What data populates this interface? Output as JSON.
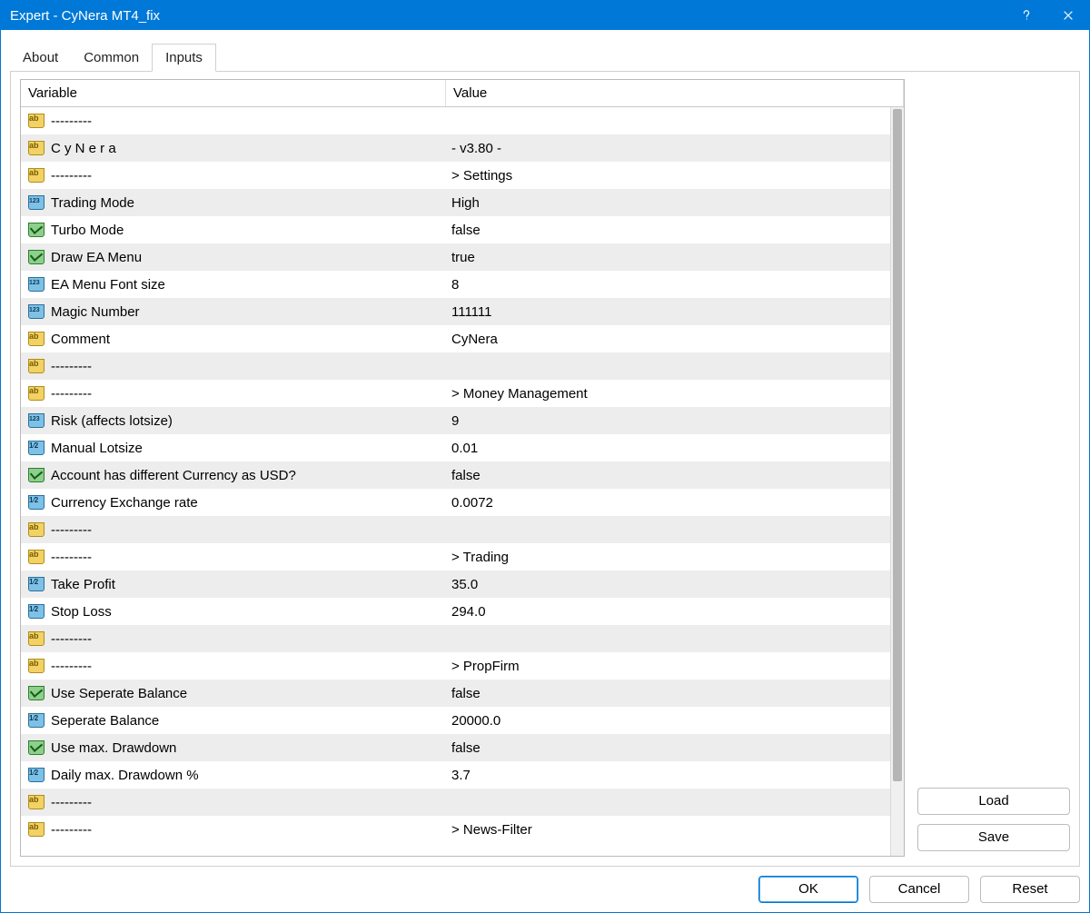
{
  "window": {
    "title": "Expert - CyNera MT4_fix"
  },
  "tabs": {
    "about": "About",
    "common": "Common",
    "inputs": "Inputs"
  },
  "headers": {
    "variable": "Variable",
    "value": "Value"
  },
  "buttons": {
    "load": "Load",
    "save": "Save",
    "ok": "OK",
    "cancel": "Cancel",
    "reset": "Reset"
  },
  "rows": [
    {
      "icon": "str",
      "name": "---------",
      "value": ""
    },
    {
      "icon": "str",
      "name": " C y N e r a",
      "value": "-   v3.80   -"
    },
    {
      "icon": "str",
      "name": " ---------",
      "value": " > Settings"
    },
    {
      "icon": "int",
      "name": " Trading Mode",
      "value": "High"
    },
    {
      "icon": "bool",
      "name": " Turbo Mode",
      "value": "false"
    },
    {
      "icon": "bool",
      "name": " Draw EA Menu",
      "value": "true"
    },
    {
      "icon": "int",
      "name": " EA Menu Font size",
      "value": "8"
    },
    {
      "icon": "int",
      "name": " Magic Number",
      "value": "111111"
    },
    {
      "icon": "str",
      "name": " Comment",
      "value": "CyNera"
    },
    {
      "icon": "str",
      "name": "---------",
      "value": ""
    },
    {
      "icon": "str",
      "name": " ---------",
      "value": " > Money Management"
    },
    {
      "icon": "int",
      "name": " Risk (affects lotsize)",
      "value": "9"
    },
    {
      "icon": "dbl",
      "name": " Manual Lotsize",
      "value": "0.01"
    },
    {
      "icon": "bool",
      "name": " Account has different Currency as USD?",
      "value": "false"
    },
    {
      "icon": "dbl",
      "name": " Currency Exchange rate",
      "value": "0.0072"
    },
    {
      "icon": "str",
      "name": " ---------",
      "value": ""
    },
    {
      "icon": "str",
      "name": " ---------",
      "value": " > Trading"
    },
    {
      "icon": "dbl",
      "name": " Take Profit",
      "value": "35.0"
    },
    {
      "icon": "dbl",
      "name": " Stop Loss",
      "value": "294.0"
    },
    {
      "icon": "str",
      "name": " ---------",
      "value": ""
    },
    {
      "icon": "str",
      "name": " ---------",
      "value": " > PropFirm"
    },
    {
      "icon": "bool",
      "name": " Use Seperate Balance",
      "value": "false"
    },
    {
      "icon": "dbl",
      "name": " Seperate Balance",
      "value": "20000.0"
    },
    {
      "icon": "bool",
      "name": " Use max. Drawdown",
      "value": "false"
    },
    {
      "icon": "dbl",
      "name": " Daily max. Drawdown %",
      "value": "3.7"
    },
    {
      "icon": "str",
      "name": " ---------",
      "value": ""
    },
    {
      "icon": "str",
      "name": " ---------",
      "value": " > News-Filter"
    }
  ]
}
